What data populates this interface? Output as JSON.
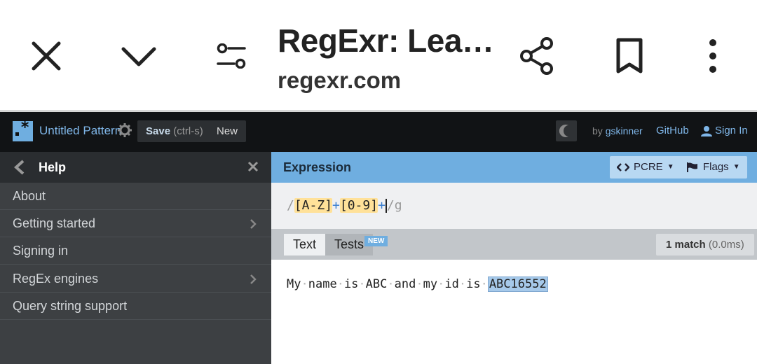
{
  "browser": {
    "title": "RegExr: Lea…",
    "url": "regexr.com",
    "icons": [
      "close-icon",
      "chevron-down-icon",
      "page-settings-icon",
      "share-icon",
      "bookmark-icon",
      "more-vert-icon"
    ]
  },
  "header": {
    "pattern_name": "Untitled Pattern",
    "save_label": "Save",
    "save_hint": "(ctrl-s)",
    "new_label": "New",
    "by_label": "by",
    "author": "gskinner",
    "github": "GitHub",
    "signin": "Sign In"
  },
  "sidebar": {
    "title": "Help",
    "items": [
      {
        "label": "About",
        "has_chevron": false
      },
      {
        "label": "Getting started",
        "has_chevron": true
      },
      {
        "label": "Signing in",
        "has_chevron": false
      },
      {
        "label": "RegEx engines",
        "has_chevron": true
      },
      {
        "label": "Query string support",
        "has_chevron": false
      }
    ]
  },
  "expression": {
    "label": "Expression",
    "engine": "PCRE",
    "flags_label": "Flags",
    "open_delim": "/",
    "set1": "[A-Z]",
    "quant1": "+",
    "set2": "[0-9]",
    "quant2": "+",
    "close_delim": "/",
    "flags": "g"
  },
  "text": {
    "tab_text": "Text",
    "tab_tests": "Tests",
    "new_badge": "NEW",
    "match_count": "1 match",
    "match_time": "(0.0ms)",
    "words": [
      "My",
      "name",
      "is",
      "ABC",
      "and",
      "my",
      "id",
      "is"
    ],
    "match": "ABC16552"
  },
  "colors": {
    "accent": "#6faee0",
    "header_bg": "#111315",
    "sidebar_bg": "#3d4043",
    "match_bg": "#a6c9ea",
    "charset_bg": "#ffe199"
  }
}
